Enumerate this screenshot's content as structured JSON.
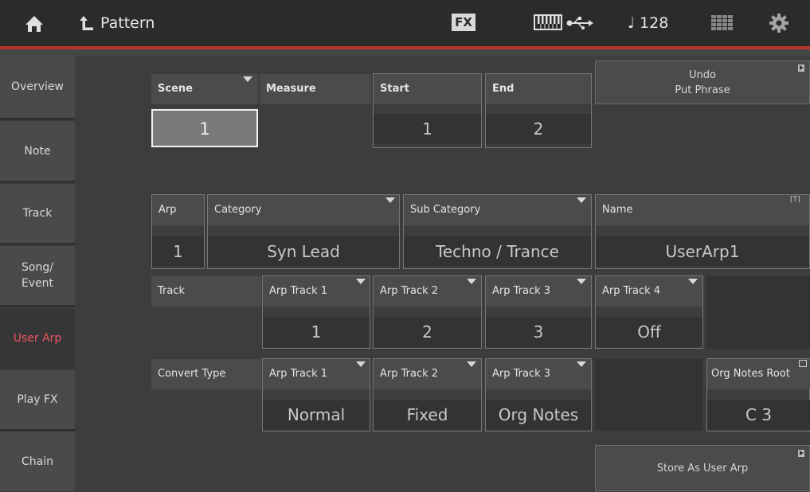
{
  "topbar": {
    "title": "Pattern",
    "fx_label": "FX",
    "tempo": "128",
    "note_symbol": "♩",
    "icons": [
      "home-icon",
      "back-arrow-icon",
      "keyboard-icon",
      "usb-icon",
      "grid-icon",
      "gear-icon"
    ]
  },
  "sidebar": {
    "items": [
      {
        "label": "Overview"
      },
      {
        "label": "Note"
      },
      {
        "label": "Track"
      },
      {
        "label": "Song/\nEvent"
      },
      {
        "label": "User Arp"
      },
      {
        "label": "Play FX"
      },
      {
        "label": "Chain"
      }
    ],
    "active": "User Arp",
    "active_color": "#ef5363"
  },
  "scene": {
    "header": "Scene",
    "value": "1"
  },
  "measure": {
    "header": "Measure"
  },
  "start": {
    "header": "Start",
    "value": "1"
  },
  "end": {
    "header": "End",
    "value": "2"
  },
  "undo": {
    "line1": "Undo",
    "line2": "Put Phrase"
  },
  "arp": {
    "header": "Arp",
    "value": "1"
  },
  "category": {
    "header": "Category",
    "value": "Syn Lead"
  },
  "subcategory": {
    "header": "Sub Category",
    "value": "Techno / Trance"
  },
  "name": {
    "header": "Name",
    "value": "UserArp1",
    "badge": "[T]"
  },
  "track_row": {
    "header": "Track",
    "tracks": [
      {
        "header": "Arp Track 1",
        "value": "1"
      },
      {
        "header": "Arp Track 2",
        "value": "2"
      },
      {
        "header": "Arp Track 3",
        "value": "3"
      },
      {
        "header": "Arp Track 4",
        "value": "Off"
      }
    ]
  },
  "convert_row": {
    "header": "Convert Type",
    "tracks": [
      {
        "header": "Arp Track 1",
        "value": "Normal"
      },
      {
        "header": "Arp Track 2",
        "value": "Fixed"
      },
      {
        "header": "Arp Track 3",
        "value": "Org Notes"
      }
    ]
  },
  "org_notes_root": {
    "header": "Org Notes Root",
    "value": "C 3"
  },
  "store_button": {
    "label": "Store As User Arp"
  }
}
